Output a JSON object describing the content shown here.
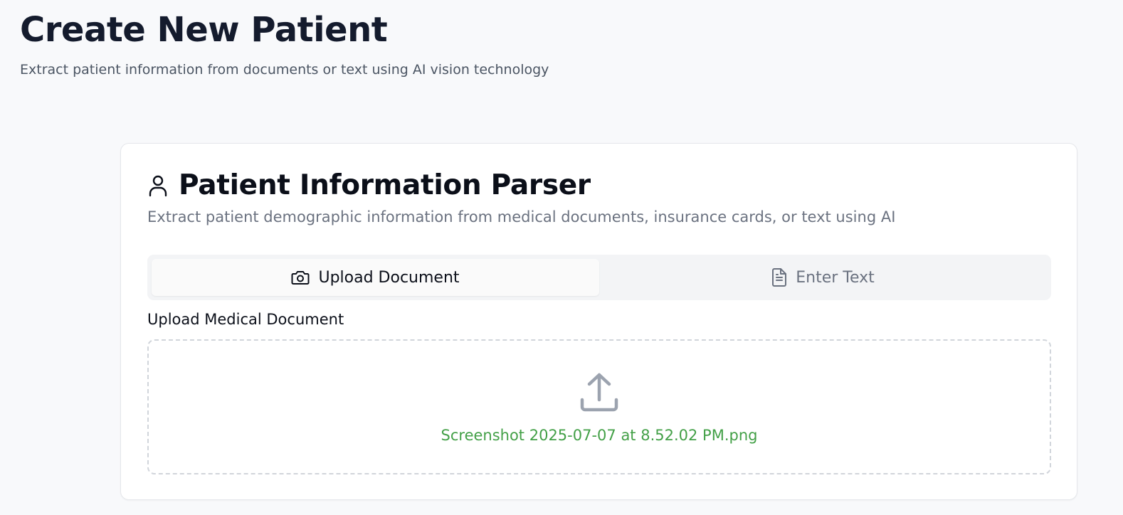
{
  "page": {
    "title": "Create New Patient",
    "subtitle": "Extract patient information from documents or text using AI vision technology"
  },
  "card": {
    "icon": "user-icon",
    "title": "Patient Information Parser",
    "description": "Extract patient demographic information from medical documents, insurance cards, or text using AI"
  },
  "tabs": [
    {
      "label": "Upload Document",
      "icon": "camera-icon",
      "active": true
    },
    {
      "label": "Enter Text",
      "icon": "document-icon",
      "active": false
    }
  ],
  "upload": {
    "label": "Upload Medical Document",
    "icon": "upload-icon",
    "file_name": "Screenshot 2025-07-07 at 8.52.02 PM.png"
  },
  "colors": {
    "background": "#f8f9fb",
    "file_name": "#43a047",
    "muted": "#6b7280"
  }
}
